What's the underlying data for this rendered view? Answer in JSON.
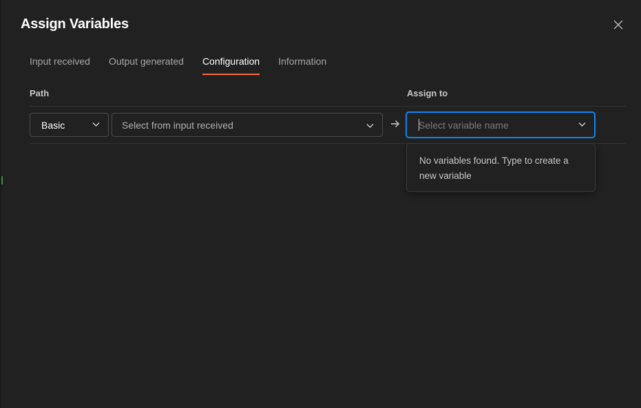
{
  "dialog": {
    "title": "Assign Variables"
  },
  "tabs": [
    {
      "label": "Input received",
      "active": false
    },
    {
      "label": "Output generated",
      "active": false
    },
    {
      "label": "Configuration",
      "active": true
    },
    {
      "label": "Information",
      "active": false
    }
  ],
  "columns": {
    "path": "Path",
    "assign_to": "Assign to"
  },
  "row": {
    "mode_select": {
      "value": "Basic"
    },
    "path_select": {
      "placeholder": "Select from input received"
    },
    "assign_input": {
      "value": "",
      "placeholder": "Select variable name"
    }
  },
  "dropdown": {
    "empty_message": "No variables found. Type to create a new variable"
  },
  "colors": {
    "background": "#212121",
    "accent_tab": "#ff6c37",
    "focus_border": "#0f86f5"
  },
  "icons": {
    "close": "close-icon",
    "chevron": "chevron-down-icon",
    "arrow": "arrow-right-icon"
  }
}
